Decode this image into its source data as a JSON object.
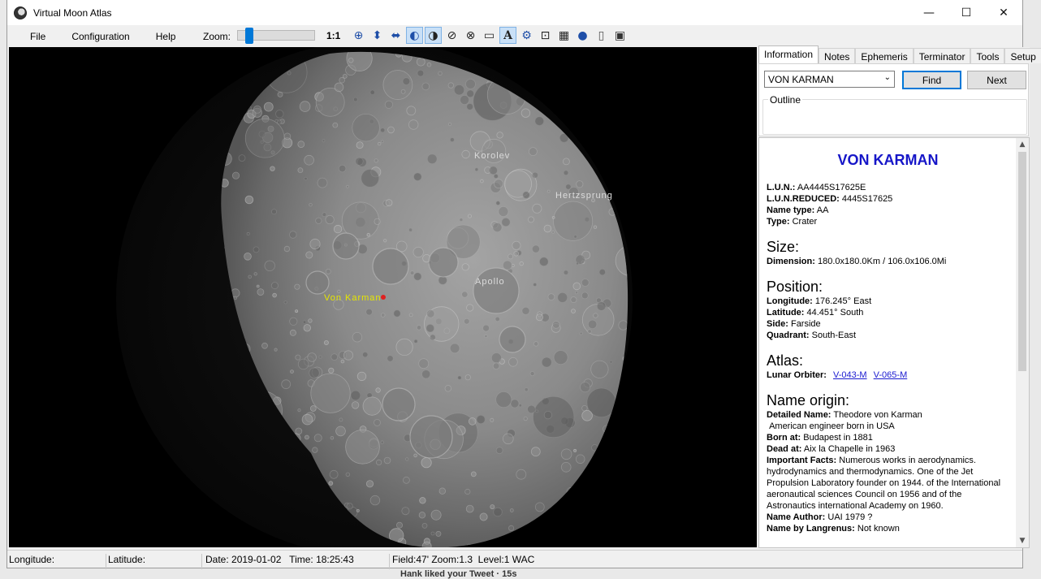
{
  "window": {
    "title": "Virtual Moon Atlas",
    "minimize": "—",
    "maximize": "☐",
    "close": "✕"
  },
  "menu": [
    "File",
    "Configuration",
    "Help"
  ],
  "zoom": {
    "label": "Zoom:",
    "ratio": "1:1",
    "level": 0.1
  },
  "toolbar_icons": [
    "globe-grid-icon",
    "flip-vertical-icon",
    "flip-horizontal-icon",
    "moon-3d-icon",
    "phase-icon",
    "orbit-icon",
    "grid-globe-icon",
    "ruler-icon",
    "label-icon",
    "gear-icon",
    "camera-icon",
    "calendar-icon",
    "earth-icon",
    "page-icon",
    "screen-icon"
  ],
  "map": {
    "labels": [
      {
        "text": "Korolev",
        "highlight": false
      },
      {
        "text": "Hertzsprung",
        "highlight": false
      },
      {
        "text": "Apollo",
        "highlight": false
      },
      {
        "text": "Von Karman",
        "highlight": true
      }
    ]
  },
  "tabs": [
    "Information",
    "Notes",
    "Ephemeris",
    "Terminator",
    "Tools",
    "Setup"
  ],
  "search": {
    "value": "VON KARMAN",
    "find_label": "Find",
    "next_label": "Next",
    "outline_label": "Outline"
  },
  "info": {
    "name": "VON KARMAN",
    "lun_label": "L.U.N.:",
    "lun": "AA4445S17625E",
    "lun_reduced_label": "L.U.N.REDUCED:",
    "lun_reduced": "4445S17625",
    "name_type_label": "Name type:",
    "name_type": "AA",
    "type_label": "Type:",
    "type": "Crater",
    "size_heading": "Size:",
    "dimension_label": "Dimension:",
    "dimension": "180.0x180.0Km / 106.0x106.0Mi",
    "position_heading": "Position:",
    "longitude_label": "Longitude:",
    "longitude": "176.245° East",
    "latitude_label": "Latitude:",
    "latitude": "44.451° South",
    "side_label": "Side:",
    "side": "Farside",
    "quadrant_label": "Quadrant:",
    "quadrant": "South-East",
    "atlas_heading": "Atlas:",
    "lunar_orbiter_label": "Lunar Orbiter:",
    "orbiter_link_1": "V-043-M",
    "orbiter_link_2": "V-065-M",
    "origin_heading": "Name origin:",
    "detailed_name_label": "Detailed Name:",
    "detailed_name": "Theodore von Karman",
    "description": "American engineer born in USA",
    "born_label": "Born at:",
    "born": "Budapest in 1881",
    "dead_label": "Dead at:",
    "dead": "Aix la Chapelle in 1963",
    "facts_label": "Important Facts:",
    "facts": "Numerous works in aerodynamics. hydrodynamics and thermodynamics. One of the Jet Propulsion Laboratory founder on 1944. of the International aeronautical sciences Council on 1956 and of the Astronautics international Academy on 1960.",
    "author_label": "Name Author:",
    "author": "UAI 1979 ?",
    "langrenus_label": "Name by Langrenus:",
    "langrenus": "Not known"
  },
  "status": {
    "longitude": "Longitude:",
    "latitude": "Latitude:",
    "date": "Date: 2019-01-02   Time: 18:25:43",
    "field": "Field:47' Zoom:1.3  Level:1 WAC"
  },
  "background": {
    "tweet_text": "Hank liked your Tweet · 15s"
  }
}
